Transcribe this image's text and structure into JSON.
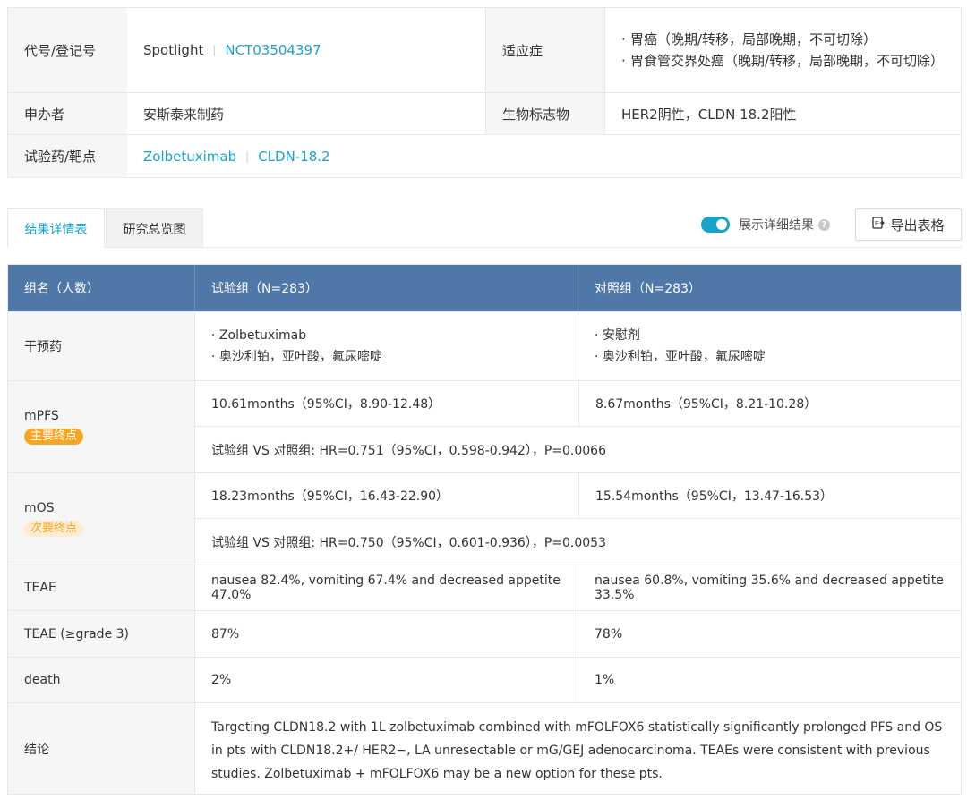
{
  "info": {
    "code_label": "代号/登记号",
    "code_name": "Spotlight",
    "code_sep": "|",
    "registry": "NCT03504397",
    "indication_label": "适应症",
    "indications": [
      "胃癌（晚期/转移，局部晚期，不可切除）",
      "胃食管交界处癌（晚期/转移，局部晚期，不可切除）"
    ],
    "sponsor_label": "申办者",
    "sponsor": "安斯泰来制药",
    "biomarker_label": "生物标志物",
    "biomarker": "HER2阴性，CLDN 18.2阳性",
    "drug_label": "试验药/靶点",
    "drug": "Zolbetuximab",
    "target": "CLDN-18.2"
  },
  "tabs": [
    {
      "label": "结果详情表",
      "active": true
    },
    {
      "label": "研究总览图",
      "active": false
    }
  ],
  "toggle": {
    "label": "展示详细结果",
    "on": true,
    "help": "?"
  },
  "export": {
    "label": "导出表格",
    "icon": "export-table-icon"
  },
  "results": {
    "headers": [
      "组名（人数）",
      "试验组（N=283）",
      "对照组（N=283）"
    ],
    "intervention": {
      "label": "干预药",
      "trial": [
        "Zolbetuximab",
        "奥沙利铂，亚叶酸，氟尿嘧啶"
      ],
      "control": [
        "安慰剂",
        "奥沙利铂，亚叶酸，氟尿嘧啶"
      ]
    },
    "mpfs": {
      "label": "mPFS",
      "badge": "主要终点",
      "trial": "10.61months（95%CI，8.90-12.48）",
      "control": "8.67months（95%CI，8.21-10.28）",
      "comparison": "试验组 VS 对照组: HR=0.751（95%CI，0.598-0.942），P=0.0066"
    },
    "mos": {
      "label": "mOS",
      "badge": "次要终点",
      "trial": "18.23months（95%CI，16.43-22.90）",
      "control": "15.54months（95%CI，13.47-16.53）",
      "comparison": "试验组 VS 对照组: HR=0.750（95%CI，0.601-0.936），P=0.0053"
    },
    "teae": {
      "label": "TEAE",
      "trial": "nausea 82.4%, vomiting 67.4% and decreased appetite 47.0%",
      "control": "nausea 60.8%, vomiting 35.6% and decreased appetite 33.5%"
    },
    "teae3": {
      "label": "TEAE (≥grade 3)",
      "trial": "87%",
      "control": "78%"
    },
    "death": {
      "label": "death",
      "trial": "2%",
      "control": "1%"
    },
    "conclusion": {
      "label": "结论",
      "text": "Targeting CLDN18.2 with 1L zolbetuximab combined with mFOLFOX6 statistically significantly prolonged PFS and OS in pts with CLDN18.2+/ HER2−, LA unresectable or mG/GEJ adenocarcinoma. TEAEs were consistent with previous studies. Zolbetuximab + mFOLFOX6 may be a new option for these pts."
    }
  },
  "colors": {
    "accent": "#1aa3c8",
    "header_bg": "#4f78a8",
    "badge": "#f5a623"
  }
}
